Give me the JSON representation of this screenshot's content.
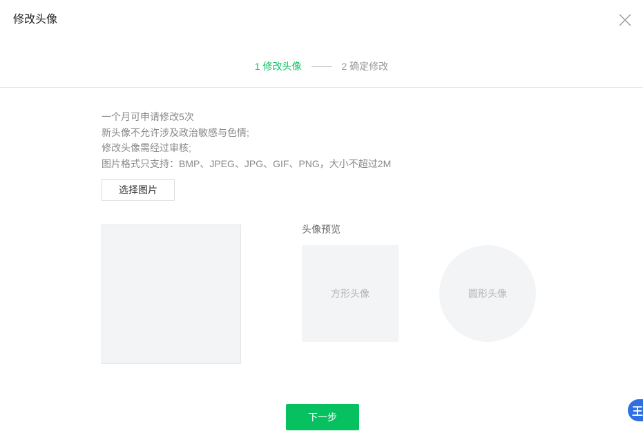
{
  "dialog": {
    "title": "修改头像"
  },
  "steps": [
    {
      "label": "1 修改头像",
      "state": "active"
    },
    {
      "label": "2 确定修改",
      "state": "inactive"
    }
  ],
  "notes": [
    "一个月可申请修改5次",
    "新头像不允许涉及政治敏感与色情;",
    "修改头像需经过审核;",
    "图片格式只支持：BMP、JPEG、JPG、GIF、PNG，大小不超过2M"
  ],
  "choose_button_label": "选择图片",
  "preview": {
    "label": "头像预览",
    "square_label": "方形头像",
    "circle_label": "圆形头像"
  },
  "next_button_label": "下一步",
  "floating_badge_text": "王",
  "colors": {
    "accent": "#07c160",
    "placeholder_bg": "#f3f4f6",
    "badge": "#2f6fe4"
  },
  "icons": {
    "close": "close-icon"
  }
}
